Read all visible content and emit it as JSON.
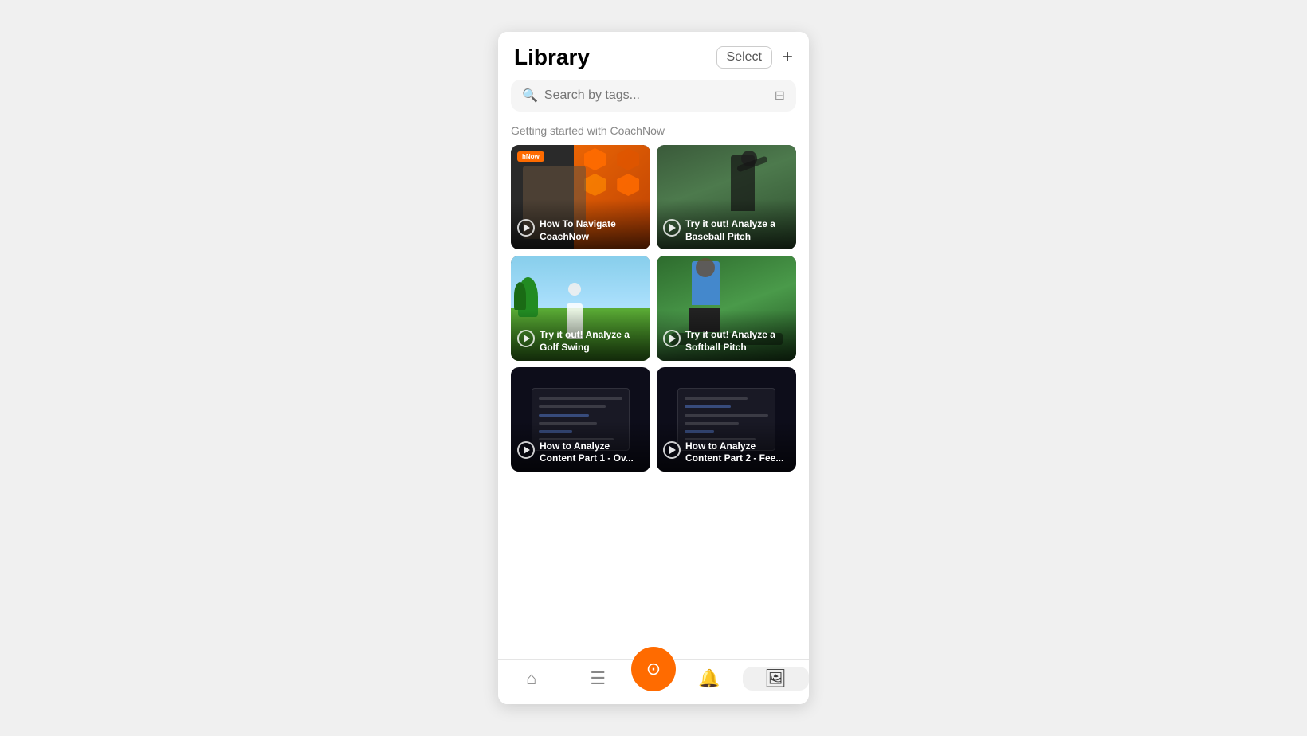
{
  "header": {
    "title": "Library",
    "select_label": "Select",
    "add_label": "+"
  },
  "search": {
    "placeholder": "Search by tags..."
  },
  "section": {
    "title": "Getting started with CoachNow"
  },
  "videos": [
    {
      "id": "navigate",
      "title": "How To Navigate CoachNow",
      "thumb_type": "navigate",
      "has_coachnow_badge": true
    },
    {
      "id": "baseball",
      "title": "Try it out! Analyze a Baseball Pitch",
      "thumb_type": "baseball",
      "has_coachnow_badge": false
    },
    {
      "id": "golf",
      "title": "Try it out! Analyze a Golf Swing",
      "thumb_type": "golf",
      "has_coachnow_badge": false
    },
    {
      "id": "softball",
      "title": "Try it out! Analyze a Softball Pitch",
      "thumb_type": "softball",
      "has_coachnow_badge": false
    },
    {
      "id": "analyze1",
      "title": "How to Analyze Content Part 1 - Ov...",
      "thumb_type": "analyze1",
      "has_coachnow_badge": false
    },
    {
      "id": "analyze2",
      "title": "How to Analyze Content Part 2 - Fee...",
      "thumb_type": "analyze2",
      "has_coachnow_badge": false
    }
  ],
  "nav": {
    "items": [
      {
        "id": "home",
        "icon": "⌂",
        "label": "Home",
        "active": false
      },
      {
        "id": "list",
        "icon": "☰",
        "label": "List",
        "active": false
      },
      {
        "id": "camera",
        "icon": "◎",
        "label": "Camera",
        "active": false,
        "is_fab": true
      },
      {
        "id": "bell",
        "icon": "🔔",
        "label": "Notifications",
        "active": false
      },
      {
        "id": "media",
        "icon": "🖼",
        "label": "Media",
        "active": true
      }
    ]
  }
}
